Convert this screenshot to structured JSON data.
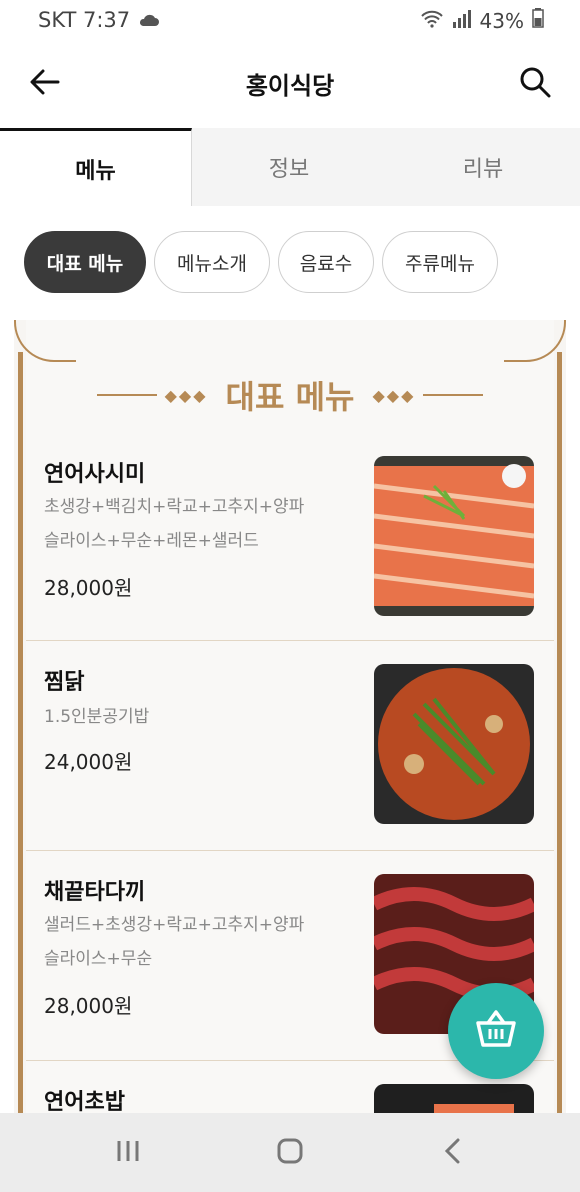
{
  "status_bar": {
    "carrier_time": "SKT 7:37",
    "battery": "43%"
  },
  "header": {
    "title": "홍이식당"
  },
  "tabs": [
    {
      "label": "메뉴"
    },
    {
      "label": "정보"
    },
    {
      "label": "리뷰"
    }
  ],
  "categories": [
    {
      "label": "대표 메뉴"
    },
    {
      "label": "메뉴소개"
    },
    {
      "label": "음료수"
    },
    {
      "label": "주류메뉴"
    }
  ],
  "section": {
    "title": "대표 메뉴"
  },
  "items": [
    {
      "name": "연어사시미",
      "desc_line1": "초생강+백김치+락교+고추지+양파",
      "desc_line2": "슬라이스+무순+레몬+샐러드",
      "price": "28,000원"
    },
    {
      "name": "찜닭",
      "desc_line1": "1.5인분공기밥",
      "desc_line2": "",
      "price": "24,000원"
    },
    {
      "name": "채끝타다끼",
      "desc_line1": "샐러드+초생강+락교+고추지+양파",
      "desc_line2": "슬라이스+무순",
      "price": "28,000원"
    },
    {
      "name": "연어초밥",
      "desc_line1": "",
      "desc_line2": "",
      "price": ""
    }
  ],
  "colors": {
    "accent_gold": "#b68a55",
    "fab": "#2cb7ab",
    "chip_active": "#3a3a3a"
  },
  "icons": {
    "back": "arrow-left-icon",
    "search": "search-icon",
    "cart": "basket-icon",
    "nav_recent": "recent-apps-icon",
    "nav_home": "home-icon",
    "nav_back": "nav-back-icon"
  }
}
